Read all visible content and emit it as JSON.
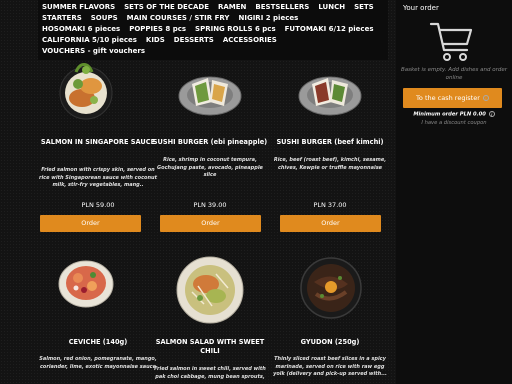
{
  "categories": [
    "SUMMER FLAVORS",
    "SETS OF THE DECADE",
    "RAMEN",
    "BESTSELLERS",
    "LUNCH",
    "SETS",
    "STARTERS",
    "SOUPS",
    "MAIN COURSES / STIR FRY",
    "NIGIRI 2 pieces",
    "HOSOMAKI 6 pieces",
    "POPPIES 8 pcs",
    "SPRING ROLLS 6 pcs",
    "FUTOMAKI 6/12 pieces",
    "CALIFORNIA 5/10 pieces",
    "KIDS",
    "DESSERTS",
    "ACCESSORIES",
    "VOUCHERS - gift vouchers"
  ],
  "basket": {
    "title": "Your order",
    "empty_text": "Basket is empty. Add dishes and order online",
    "cash_register_label": "To the cash register",
    "min_order": "Minimum order PLN 0.00",
    "discount_text": "I have a discount coupon"
  },
  "products": [
    {
      "name": "SALMON IN SINGAPORE SAUCE",
      "description": "Fried salmon with crispy skin, served on rice with Singaporean sauce with coconut milk, stir-fry vegetables, mang..",
      "price": "PLN 59.00",
      "order_label": "Order"
    },
    {
      "name": "SUSHI BURGER (ebi pineapple)",
      "description": "Rice, shrimp in coconut tempura, Gochujang paste, avocado, pineapple slice",
      "price": "PLN 39.00",
      "order_label": "Order"
    },
    {
      "name": "SUSHI BURGER (beef kimchi)",
      "description": "Rice, beef (roast beef), kimchi, sesame, chives, Kewpie or truffle mayonnaise",
      "price": "PLN 37.00",
      "order_label": "Order"
    },
    {
      "name": "CEVICHE (140g)",
      "description": "Salmon, red onion, pomegranate, mango, coriander, lime, exotic mayonnaise sauce",
      "price": "",
      "order_label": ""
    },
    {
      "name": "SALMON SALAD WITH SWEET CHILI",
      "description": "Fried salmon in sweet chili, served with pak choi cabbage, mung bean sprouts,",
      "price": "",
      "order_label": ""
    },
    {
      "name": "GYUDON (250g)",
      "description": "Thinly sliced roast beef slices in a spicy marinade, served on rice with raw egg yolk (delivery and pick-up served with...",
      "price": "",
      "order_label": ""
    }
  ],
  "colors": {
    "accent": "#e08a1e",
    "background": "#131313",
    "sidebar": "#0d0d0d"
  }
}
